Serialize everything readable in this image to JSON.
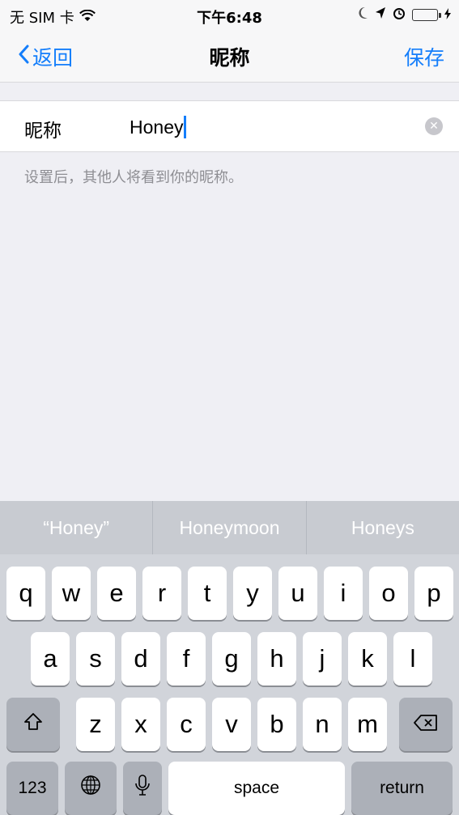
{
  "status_bar": {
    "carrier": "无 SIM 卡",
    "time": "下午6:48",
    "battery_color": "#4cd964"
  },
  "nav": {
    "back_label": "返回",
    "title": "昵称",
    "save_label": "保存",
    "accent": "#147efb"
  },
  "form": {
    "label": "昵称",
    "value": "Honey",
    "hint": "设置后，其他人将看到你的昵称。"
  },
  "keyboard": {
    "suggestions": [
      "“Honey”",
      "Honeymoon",
      "Honeys"
    ],
    "row1": [
      "q",
      "w",
      "e",
      "r",
      "t",
      "y",
      "u",
      "i",
      "o",
      "p"
    ],
    "row2": [
      "a",
      "s",
      "d",
      "f",
      "g",
      "h",
      "j",
      "k",
      "l"
    ],
    "row3": [
      "z",
      "x",
      "c",
      "v",
      "b",
      "n",
      "m"
    ],
    "numbers_label": "123",
    "space_label": "space",
    "return_label": "return",
    "icons": [
      "shift-icon",
      "backspace-icon",
      "globe-icon",
      "microphone-icon"
    ]
  }
}
